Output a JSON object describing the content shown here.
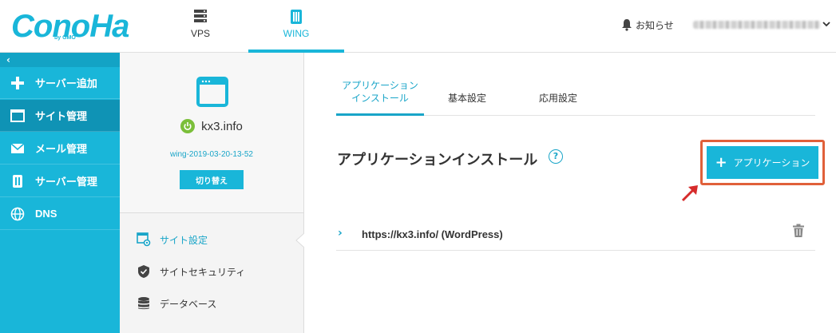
{
  "brand": {
    "logo_text": "ConoHa",
    "logo_sub": "by GMO",
    "color": "#19b6d9"
  },
  "header": {
    "tabs": [
      {
        "label": "VPS",
        "icon": "server-icon"
      },
      {
        "label": "WING",
        "icon": "wing-icon"
      }
    ],
    "notice_label": "お知らせ"
  },
  "sidebar": {
    "collapse_icon": "chevron-left-icon",
    "items": [
      {
        "label": "サーバー追加",
        "icon": "plus-icon"
      },
      {
        "label": "サイト管理",
        "icon": "window-icon"
      },
      {
        "label": "メール管理",
        "icon": "mail-icon"
      },
      {
        "label": "サーバー管理",
        "icon": "server-manage-icon"
      },
      {
        "label": "DNS",
        "icon": "globe-icon"
      }
    ]
  },
  "site": {
    "name": "kx3.info",
    "id": "wing-2019-03-20-13-52",
    "switch_label": "切り替え",
    "status_color": "#7bbf3a"
  },
  "sub_nav": {
    "items": [
      {
        "label": "サイト設定",
        "icon": "site-settings-icon"
      },
      {
        "label": "サイトセキュリティ",
        "icon": "shield-icon"
      },
      {
        "label": "データベース",
        "icon": "database-icon"
      }
    ]
  },
  "content": {
    "tabs": [
      {
        "line1": "アプリケーション",
        "line2": "インストール"
      },
      {
        "line1": "基本設定",
        "line2": ""
      },
      {
        "line1": "応用設定",
        "line2": ""
      }
    ],
    "title": "アプリケーションインストール",
    "help_label": "?",
    "add_button_label": "アプリケーション",
    "add_button_plus": "+",
    "apps": [
      {
        "chevron": "›",
        "url": "https://kx3.info/ (WordPress)"
      }
    ],
    "highlight_color": "#e0603a"
  }
}
